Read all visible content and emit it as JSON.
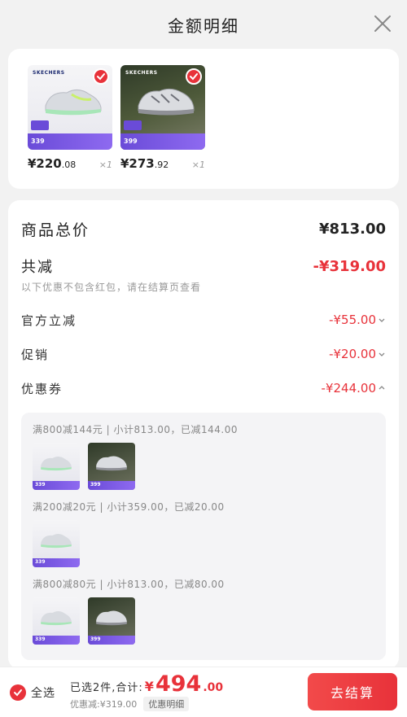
{
  "header": {
    "title": "金额明细"
  },
  "products": [
    {
      "price_int": "¥220",
      "price_dec": ".08",
      "qty": "×1",
      "thumb_tone": "light",
      "brand": "SKECHERS",
      "promo_price": "339",
      "checked": true
    },
    {
      "price_int": "¥273",
      "price_dec": ".92",
      "qty": "×1",
      "thumb_tone": "dark",
      "brand": "SKECHERS",
      "promo_price": "399",
      "checked": true
    }
  ],
  "summary": {
    "total_label": "商品总价",
    "total_value": "¥813.00",
    "discount_label": "共减",
    "discount_value": "-¥319.00",
    "note": "以下优惠不包含红包，请在结算页查看",
    "official_label": "官方立减",
    "official_value": "-¥55.00",
    "promo_label": "促销",
    "promo_value": "-¥20.00",
    "coupon_label": "优惠券",
    "coupon_value": "-¥244.00"
  },
  "coupons": [
    {
      "text": "满800减144元 | 小计813.00，已减144.00",
      "items": [
        "light",
        "dark"
      ]
    },
    {
      "text": "满200减20元 | 小计359.00，已减20.00",
      "items": [
        "light"
      ]
    },
    {
      "text": "满800减80元 | 小计813.00，已减80.00",
      "items": [
        "light",
        "dark"
      ]
    }
  ],
  "footer": {
    "select_all": "全选",
    "selected_text": "已选2件,合计:",
    "amount_yen": "¥",
    "amount_int": "494",
    "amount_dec": ".00",
    "saved_text": "优惠减:¥319.00",
    "detail_link": "优惠明细",
    "checkout": "去结算"
  },
  "colors": {
    "accent": "#e8323a",
    "promo_purple": "#6a4bd8"
  }
}
